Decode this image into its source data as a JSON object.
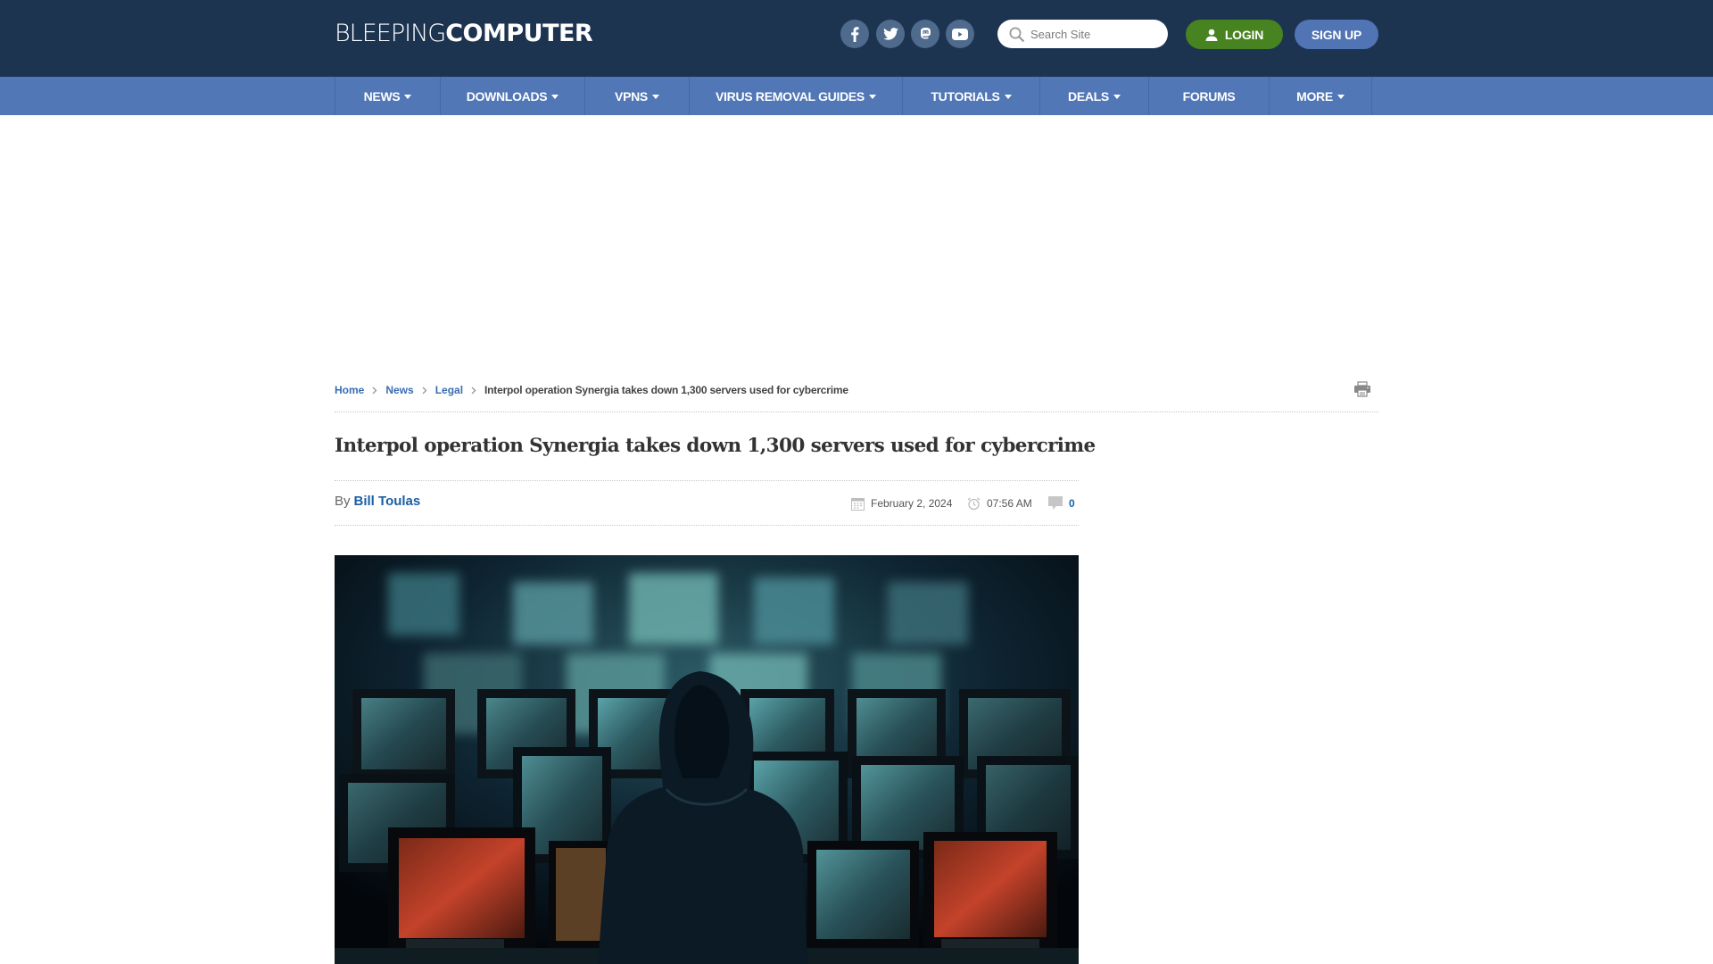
{
  "site": {
    "logo_light": "BLEEPING",
    "logo_bold": "COMPUTER"
  },
  "header": {
    "social": [
      {
        "name": "facebook",
        "icon": "facebook-icon"
      },
      {
        "name": "twitter",
        "icon": "twitter-icon"
      },
      {
        "name": "mastodon",
        "icon": "mastodon-icon"
      },
      {
        "name": "youtube",
        "icon": "youtube-icon"
      }
    ],
    "search_placeholder": "Search Site",
    "login_label": "LOGIN",
    "signup_label": "SIGN UP"
  },
  "nav": {
    "items": [
      {
        "label": "NEWS",
        "dropdown": true
      },
      {
        "label": "DOWNLOADS",
        "dropdown": true
      },
      {
        "label": "VPNS",
        "dropdown": true
      },
      {
        "label": "VIRUS REMOVAL GUIDES",
        "dropdown": true
      },
      {
        "label": "TUTORIALS",
        "dropdown": true
      },
      {
        "label": "DEALS",
        "dropdown": true
      },
      {
        "label": "FORUMS",
        "dropdown": false
      },
      {
        "label": "MORE",
        "dropdown": true
      }
    ]
  },
  "breadcrumb": {
    "items": [
      "Home",
      "News",
      "Legal"
    ],
    "current": "Interpol operation Synergia takes down 1,300 servers used for cybercrime"
  },
  "article": {
    "title": "Interpol operation Synergia takes down 1,300 servers used for cybercrime",
    "by_label": "By",
    "author": "Bill Toulas",
    "date": "February 2, 2024",
    "time": "07:56 AM",
    "comment_count": "0",
    "hero_image_alt": "Hooded figure facing a wall of computer monitors"
  },
  "colors": {
    "header_bg": "#1d3451",
    "nav_bg": "#5177b6",
    "login_green": "#478320",
    "signup_blue": "#5074b4",
    "link_blue": "#1b5fa5"
  }
}
